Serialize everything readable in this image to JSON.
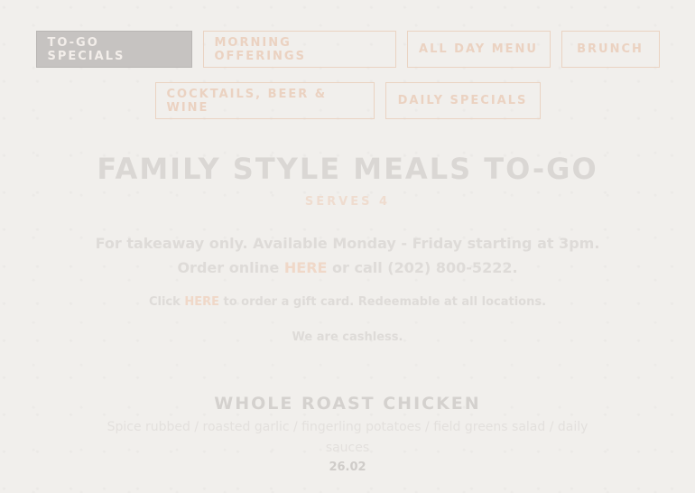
{
  "nav": {
    "tabs": [
      {
        "label": "TO-GO SPECIALS",
        "active": true
      },
      {
        "label": "MORNING OFFERINGS",
        "active": false
      },
      {
        "label": "ALL DAY MENU",
        "active": false
      },
      {
        "label": "BRUNCH",
        "active": false
      },
      {
        "label": "COCKTAILS, BEER & WINE",
        "active": false
      },
      {
        "label": "DAILY SPECIALS",
        "active": false
      }
    ]
  },
  "section": {
    "title": "FAMILY STYLE MEALS TO-GO",
    "subtitle": "SERVES 4",
    "info_text_1": "For takeaway only. Available Monday - Friday starting at 3pm. Order online ",
    "info_link": "HERE",
    "info_text_2": " or call (202) 800-5222.",
    "gift_text_1": "Click ",
    "gift_link": "HERE",
    "gift_text_2": " to order a gift card. Redeemable at all locations.",
    "cashless": "We are cashless."
  },
  "item": {
    "name": "WHOLE ROAST CHICKEN",
    "description": "Spice rubbed / roasted garlic / fingerling potatoes / field greens salad / daily sauces",
    "price": "26.02"
  },
  "colors": {
    "background": "#f1efec",
    "accent": "#ebd2c1",
    "active_tab": "#c6c3c1"
  }
}
